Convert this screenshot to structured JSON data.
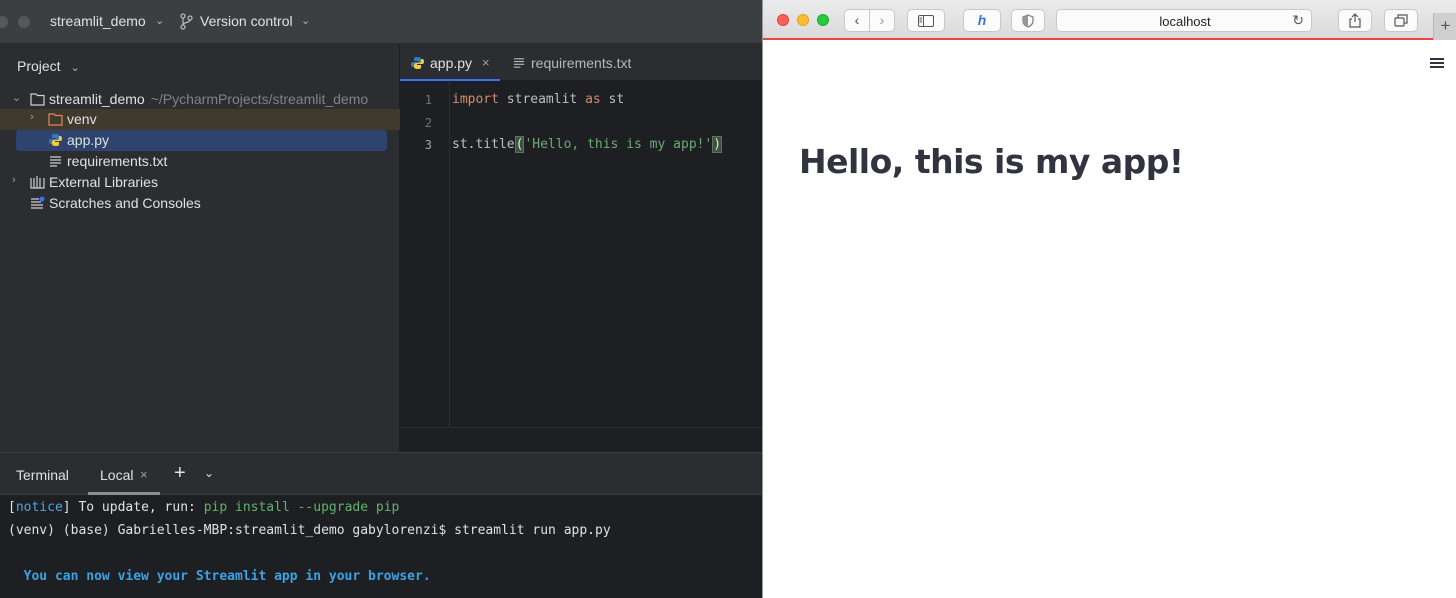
{
  "ide": {
    "topbar": {
      "project_name": "streamlit_demo",
      "version_control_label": "Version control"
    },
    "project_panel": {
      "header": "Project",
      "tree": {
        "root_name": "streamlit_demo",
        "root_path": "~/PycharmProjects/streamlit_demo",
        "venv": "venv",
        "app_file": "app.py",
        "requirements_file": "requirements.txt",
        "external_libraries": "External Libraries",
        "scratches": "Scratches and Consoles"
      }
    },
    "editor": {
      "tabs": [
        {
          "label": "app.py",
          "active": true
        },
        {
          "label": "requirements.txt",
          "active": false
        }
      ],
      "line_numbers": [
        "1",
        "2",
        "3"
      ],
      "code": {
        "line1": {
          "kw1": "import",
          "mid": " streamlit ",
          "kw2": "as",
          "tail": " st"
        },
        "line3": {
          "prefix": "st.title",
          "open_paren": "(",
          "string": "'Hello, this is my app!'",
          "close_paren": ")"
        }
      }
    },
    "terminal": {
      "title": "Terminal",
      "tab_label": "Local",
      "lines": {
        "notice_open": "[",
        "notice_word": "notice",
        "notice_mid": "] To update, run: ",
        "notice_cmd": "pip install --upgrade pip",
        "command": "(venv) (base) Gabrielles-MBP:streamlit_demo gabylorenzi$ streamlit run app.py",
        "view_msg": "  You can now view your Streamlit app in your browser."
      }
    }
  },
  "browser": {
    "address": "localhost",
    "page": {
      "title": "Hello, this is my app!"
    }
  },
  "colors": {
    "ide_bg": "#2b2d30",
    "editor_bg": "#1e1f22",
    "selection": "#2e436e",
    "keyword": "#cf8e6d",
    "string": "#6aab73",
    "terminal_blue": "#3aa3e3",
    "safari_accent": "#e8453c",
    "streamlit_text": "#31333f"
  },
  "icons": [
    "folder-icon",
    "python-file-icon",
    "text-file-icon",
    "library-icon",
    "scratches-icon",
    "branch-icon",
    "hamburger-icon",
    "reload-icon",
    "share-icon",
    "tabs-icon",
    "sidebar-icon",
    "honey-extension-icon",
    "shield-icon"
  ]
}
